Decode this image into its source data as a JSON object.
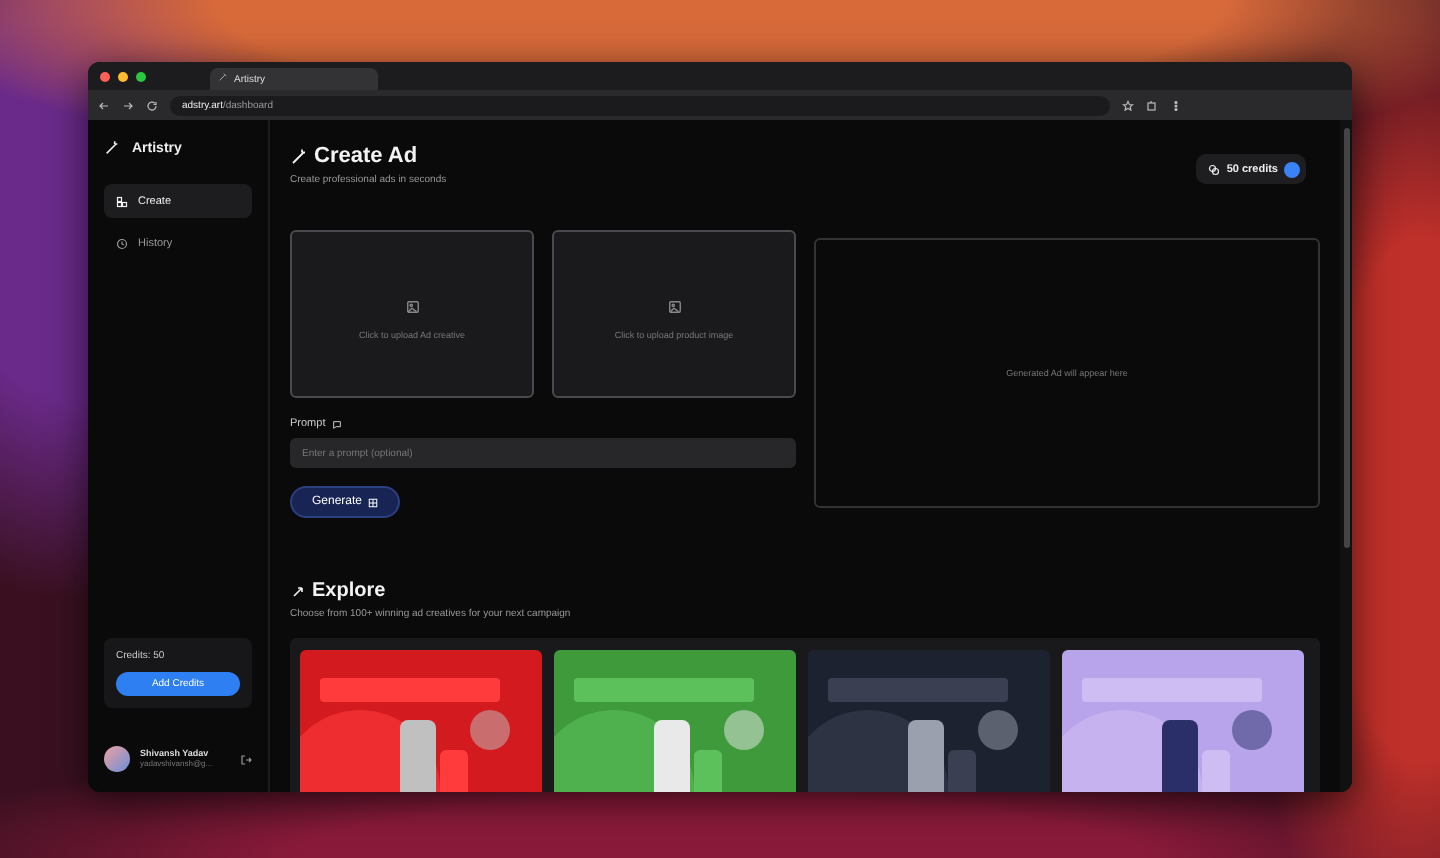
{
  "browser": {
    "tab_title": "Artistry",
    "url_host": "adstry.art",
    "url_path": "/dashboard"
  },
  "sidebar": {
    "brand": "Artistry",
    "items": [
      {
        "label": "Create",
        "selected": true,
        "kind": "create"
      },
      {
        "label": "History",
        "selected": false,
        "kind": "history"
      }
    ],
    "credits": "Credits: 50",
    "add_button": "Add Credits",
    "user": {
      "name": "Shivansh Yadav",
      "email": "yadavshivansh@g..."
    }
  },
  "header": {
    "title": "Create Ad",
    "subtitle": "Create professional ads in seconds",
    "credits_badge": "50 credits"
  },
  "uploads": [
    "Click to upload Ad creative",
    "Click to upload product image"
  ],
  "prompt": {
    "label": "Prompt",
    "placeholder": "Enter a prompt (optional)"
  },
  "generate_button": "Generate",
  "preview": "Generated Ad will appear here",
  "explore": {
    "title": "Explore",
    "subtitle": "Choose from 100+ winning ad creatives for your next campaign"
  }
}
